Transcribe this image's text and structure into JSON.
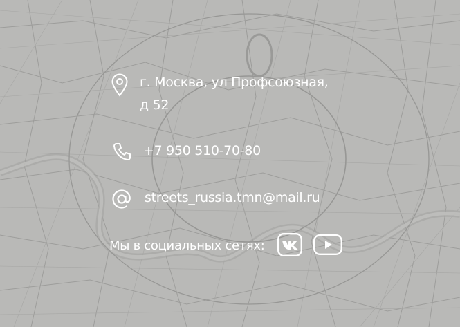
{
  "contacts": {
    "address_line1": "г. Москва, ул Профсоюзная,",
    "address_line2": "д 52",
    "phone": "+7 950 510-70-80",
    "email": "streets_russia.tmn@mail.ru"
  },
  "social": {
    "label": "Мы в социальных сетях:",
    "networks": [
      "vk-icon",
      "youtube-icon"
    ]
  },
  "icons": {
    "address": "map-pin-icon",
    "phone": "phone-icon",
    "email": "at-sign-icon"
  },
  "colors": {
    "background": "#b9b9b7",
    "map_lines": "#8f8f8d",
    "text": "#ffffff"
  }
}
